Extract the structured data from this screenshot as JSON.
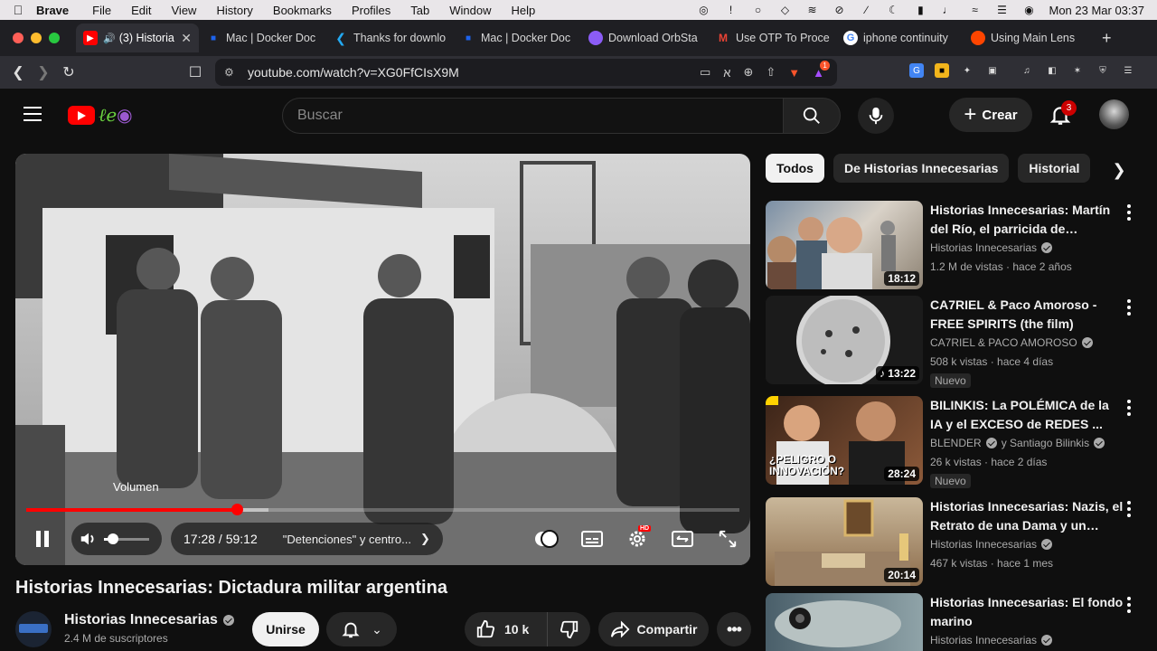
{
  "menubar": {
    "app": "Brave",
    "items": [
      "File",
      "Edit",
      "View",
      "History",
      "Bookmarks",
      "Profiles",
      "Tab",
      "Window",
      "Help"
    ],
    "clock": "Mon 23 Mar  03:37"
  },
  "tabs": [
    {
      "label": "(3) Historia",
      "icon": "youtube-icon",
      "color": "#ff0000"
    },
    {
      "label": "Mac | Docker Doc",
      "icon": "docker-icon",
      "color": "#1d63ed"
    },
    {
      "label": "Thanks for downlo",
      "icon": "vscode-icon",
      "color": "#23a9f2"
    },
    {
      "label": "Mac | Docker Doc",
      "icon": "docker-icon",
      "color": "#1d63ed"
    },
    {
      "label": "Download OrbSta",
      "icon": "orbstack-icon",
      "color": "#8b5cf6"
    },
    {
      "label": "Use OTP To Proce",
      "icon": "gmail-icon",
      "color": "#ea4335"
    },
    {
      "label": "iphone continuity",
      "icon": "google-icon",
      "color": "#4285f4"
    },
    {
      "label": "Using Main Lens",
      "icon": "reddit-icon",
      "color": "#ff4500"
    }
  ],
  "address": {
    "url": "youtube.com/watch?v=XG0FfCIsX9M",
    "brave_badge": "1"
  },
  "header": {
    "search_placeholder": "Buscar",
    "create_label": "Crear",
    "notif_count": "3"
  },
  "player": {
    "tooltip": "Volumen",
    "time": "17:28 / 59:12",
    "chapter": "\"Detenciones\" y centro...",
    "progress_fraction": 0.295,
    "loaded_fraction": 0.34,
    "volume_fraction": 0.2
  },
  "video": {
    "title": "Historias Innecesarias: Dictadura militar argentina",
    "channel": "Historias Innecesarias",
    "subscribers": "2.4 M de suscriptores",
    "join_label": "Unirse",
    "likes": "10 k",
    "share_label": "Compartir"
  },
  "chips": [
    "Todos",
    "De Historias Innecesarias",
    "Historial"
  ],
  "recommendations": [
    {
      "title": "Historias Innecesarias: Martín del Río, el parricida de Vicente...",
      "channel": "Historias Innecesarias",
      "meta": "1.2 M de vistas · hace 2 años",
      "duration": "18:12",
      "new": ""
    },
    {
      "title": "CA7RIEL & Paco Amoroso - FREE SPIRITS (the film)",
      "channel": "CA7RIEL & PACO AMOROSO",
      "meta": "508 k vistas · hace 4 días",
      "duration": "♪ 13:22",
      "new": "Nuevo"
    },
    {
      "title": "BILINKIS: La POLÉMICA de la IA y el EXCESO de REDES ...",
      "channel": "BLENDER",
      "channel2": "y Santiago Bilinkis",
      "meta": "26 k vistas · hace 2 días",
      "duration": "28:24",
      "new": "Nuevo",
      "thumb_text": "¿PELIGRO O INNOVACIÓN?"
    },
    {
      "title": "Historias Innecesarias: Nazis, el Retrato de una Dama y un avis...",
      "channel": "Historias Innecesarias",
      "meta": "467 k vistas · hace 1 mes",
      "duration": "20:14",
      "new": ""
    },
    {
      "title": "Historias Innecesarias: El fondo marino",
      "channel": "Historias Innecesarias",
      "meta": "",
      "duration": "",
      "new": ""
    }
  ]
}
